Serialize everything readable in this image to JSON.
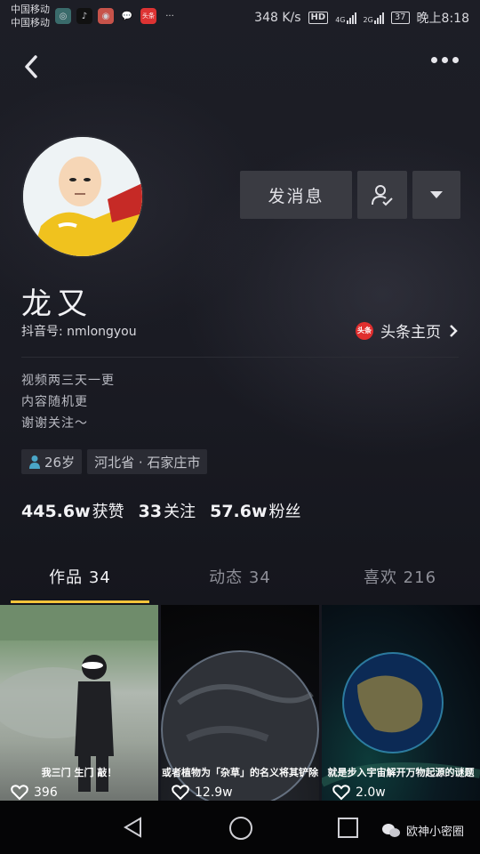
{
  "status_bar": {
    "carrier1": "中国移动",
    "carrier2": "中国移动",
    "net_speed": "348 K/s",
    "hd": "HD",
    "net1": "4G",
    "net2": "2G",
    "battery": "37",
    "time": "晚上8:18"
  },
  "profile": {
    "name": "龙又",
    "douyin_id": "抖音号: nmlongyou",
    "toutiao_label": "头条主页",
    "toutiao_badge": "头条",
    "message_btn": "发消息",
    "bio": [
      "视频两三天一更",
      "内容随机更",
      "谢谢关注～"
    ],
    "age": "26岁",
    "location": "河北省 · 石家庄市"
  },
  "stats": [
    {
      "value": "445.6w",
      "label": "获赞"
    },
    {
      "value": "33",
      "label": "关注"
    },
    {
      "value": "57.6w",
      "label": "粉丝"
    }
  ],
  "tabs": [
    {
      "label": "作品 34",
      "active": true
    },
    {
      "label": "动态 34",
      "active": false
    },
    {
      "label": "喜欢 216",
      "active": false
    }
  ],
  "videos": [
    {
      "caption": "我三门 生门 敲！",
      "likes": "396"
    },
    {
      "caption": "或者植物为「杂草」的名义将其铲除",
      "likes": "12.9w"
    },
    {
      "caption": "就是步入宇宙解开万物起源的谜题",
      "likes": "2.0w"
    }
  ],
  "watermark": "欧神小密圈",
  "colors": {
    "accent": "#f5c43a",
    "background": "#16171f",
    "button": "#3a3b42"
  }
}
